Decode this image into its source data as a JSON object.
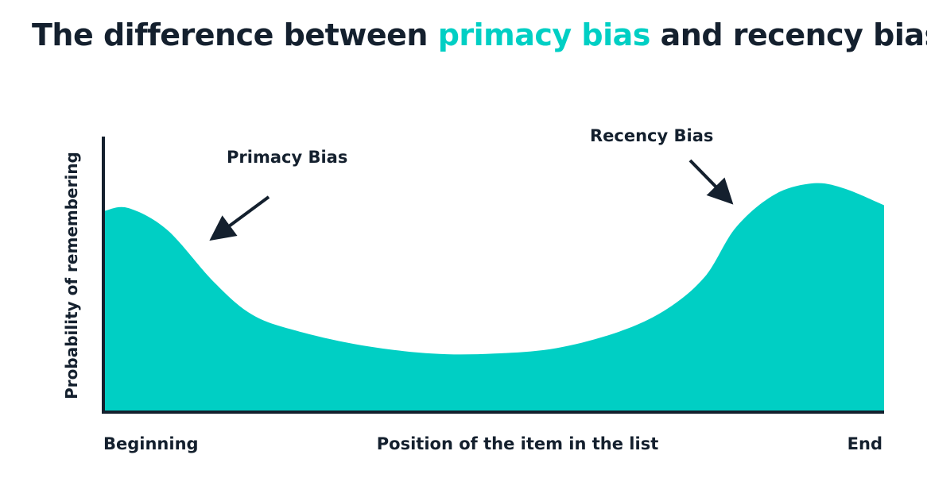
{
  "title": {
    "prefix": "The difference between ",
    "highlight": "primacy bias",
    "suffix": " and recency bias"
  },
  "colors": {
    "accent": "#00cfc4",
    "text": "#14202e",
    "axis": "#14202e"
  },
  "chart_data": {
    "type": "area",
    "title": "The difference between primacy bias and recency bias",
    "xlabel": "Position of the item in the list",
    "ylabel": "Probability of remembering",
    "x_tick_labels": [
      "Beginning",
      "End"
    ],
    "xlim": [
      0,
      1
    ],
    "ylim": [
      0,
      1
    ],
    "grid": false,
    "series": [
      {
        "x": [
          0.0,
          0.03,
          0.08,
          0.14,
          0.19,
          0.25,
          0.33,
          0.42,
          0.5,
          0.58,
          0.66,
          0.72,
          0.77,
          0.81,
          0.86,
          0.91,
          0.95,
          1.0
        ],
        "y": [
          0.73,
          0.74,
          0.66,
          0.47,
          0.35,
          0.29,
          0.24,
          0.21,
          0.21,
          0.23,
          0.29,
          0.37,
          0.49,
          0.67,
          0.79,
          0.83,
          0.81,
          0.75
        ]
      }
    ],
    "annotations": [
      {
        "text": "Primacy Bias",
        "points_to_x": 0.14
      },
      {
        "text": "Recency Bias",
        "points_to_x": 0.8
      }
    ]
  }
}
